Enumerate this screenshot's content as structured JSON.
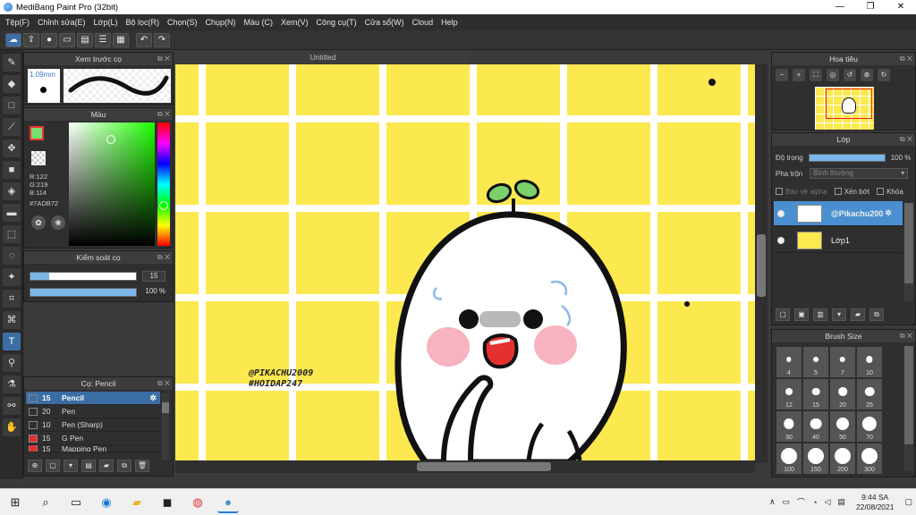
{
  "window": {
    "title": "MediBang Paint Pro (32bit)",
    "controls": [
      "—",
      "❐",
      "✕"
    ]
  },
  "menu": [
    "Tệp(F)",
    "Chỉnh sửa(E)",
    "Lớp(L)",
    "Bộ lọc(R)",
    "Chọn(S)",
    "Chụp(N)",
    "Màu (C)",
    "Xem(V)",
    "Công cụ(T)",
    "Cửa sổ(W)",
    "Cloud",
    "Help"
  ],
  "toolbar_icons": [
    "cloud-icon",
    "share-icon",
    "comment-icon",
    "chat-icon",
    "page-icon",
    "list-icon",
    "grid-icon",
    "undo-icon",
    "redo-icon"
  ],
  "brush_preview": {
    "title": "Xem trước cọ",
    "size": "1.09mm"
  },
  "color": {
    "title": "Màu",
    "r": "R:122",
    "g": "G:219",
    "b": "B:114",
    "hex": "#7ADB72",
    "fg_color": "#7ADB72"
  },
  "brush_control": {
    "title": "Kiểm soát cọ",
    "size_value": "15",
    "opacity_value": "100 %",
    "size_fraction": 0.18,
    "opacity_fraction": 1.0
  },
  "brush_list": {
    "title": "Cọ: Pencil",
    "items": [
      {
        "size": "15",
        "name": "Pencil",
        "chip": "#3b6ea5"
      },
      {
        "size": "20",
        "name": "Pen",
        "chip": "#2f2f2f"
      },
      {
        "size": "10",
        "name": "Pen (Sharp)",
        "chip": "#2f2f2f"
      },
      {
        "size": "15",
        "name": "G Pen",
        "chip": "#e03030"
      },
      {
        "size": "15",
        "name": "Mapping Pen",
        "chip": "#e03030"
      }
    ]
  },
  "document": {
    "tab": "Untitled",
    "watermark_line1": "@PIKACHU2009",
    "watermark_line2": "#HOIDAP247"
  },
  "navigator": {
    "title": "Hoa tiêu"
  },
  "layers": {
    "title": "Lớp",
    "opacity_label": "Độ trong",
    "opacity_value": "100 %",
    "blend_label": "Pha trộn",
    "blend_value": "Bình thường",
    "protect_alpha": "Bảo vệ alpha",
    "clipping": "Xén bớt",
    "lock": "Khóa",
    "items": [
      {
        "name": "@Pikachu200",
        "selected": true
      },
      {
        "name": "Lớp1",
        "selected": false
      }
    ]
  },
  "brush_size": {
    "title": "Brush Size",
    "sizes": [
      "4",
      "5",
      "7",
      "10",
      "12",
      "15",
      "20",
      "25",
      "30",
      "40",
      "50",
      "70",
      "100",
      "150",
      "200",
      "300"
    ]
  },
  "taskbar": {
    "time": "9:44 SA",
    "date": "22/08/2021"
  }
}
